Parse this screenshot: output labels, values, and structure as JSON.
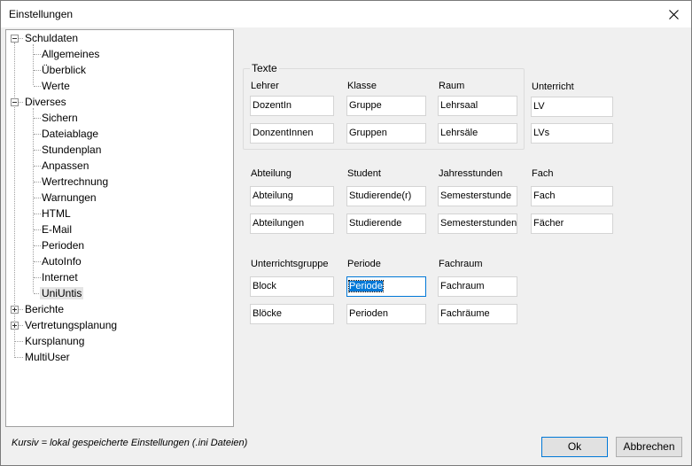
{
  "window": {
    "title": "Einstellungen"
  },
  "tree": {
    "schuldaten": "Schuldaten",
    "allgemeines": "Allgemeines",
    "ueberblick": "Überblick",
    "werte": "Werte",
    "diverses": "Diverses",
    "sichern": "Sichern",
    "dateiablage": "Dateiablage",
    "stundenplan": "Stundenplan",
    "anpassen": "Anpassen",
    "wertrechnung": "Wertrechnung",
    "warnungen": "Warnungen",
    "html": "HTML",
    "email": "E-Mail",
    "perioden": "Perioden",
    "autoinfo": "AutoInfo",
    "internet": "Internet",
    "uniuntis": "UniUntis",
    "berichte": "Berichte",
    "vertretungsplanung": "Vertretungsplanung",
    "kursplanung": "Kursplanung",
    "multiuser": "MultiUser"
  },
  "note": "Kursiv = lokal gespeicherte Einstellungen (.ini Dateien)",
  "texte": {
    "group_title": "Texte",
    "lehrer_label": "Lehrer",
    "lehrer_sg": "DozentIn",
    "lehrer_pl": "DonzentInnen",
    "klasse_label": "Klasse",
    "klasse_sg": "Gruppe",
    "klasse_pl": "Gruppen",
    "raum_label": "Raum",
    "raum_sg": "Lehrsaal",
    "raum_pl": "Lehrsäle"
  },
  "unterricht": {
    "label": "Unterricht",
    "sg": "LV",
    "pl": "LVs"
  },
  "abteilung": {
    "label": "Abteilung",
    "sg": "Abteilung",
    "pl": "Abteilungen"
  },
  "student": {
    "label": "Student",
    "sg": "Studierende(r)",
    "pl": "Studierende"
  },
  "jahresstunden": {
    "label": "Jahresstunden",
    "sg": "Semesterstunde",
    "pl": "Semesterstunden"
  },
  "fach": {
    "label": "Fach",
    "sg": "Fach",
    "pl": "Fächer"
  },
  "unterrichtsgruppe": {
    "label": "Unterrichtsgruppe",
    "sg": "Block",
    "pl": "Blöcke"
  },
  "periode": {
    "label": "Periode",
    "sg": "Periode",
    "pl": "Perioden"
  },
  "fachraum": {
    "label": "Fachraum",
    "sg": "Fachraum",
    "pl": "Fachräume"
  },
  "buttons": {
    "ok": "Ok",
    "cancel": "Abbrechen"
  }
}
